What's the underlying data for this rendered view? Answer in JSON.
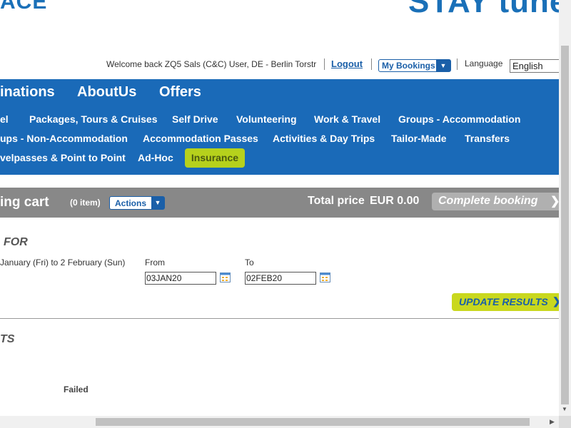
{
  "header": {
    "logo_left": "ACE",
    "logo_right": "STAY tuned"
  },
  "topbar": {
    "welcome": "Welcome back ZQ5 Sals (C&C) User, DE - Berlin Torstr",
    "logout": "Logout",
    "my_bookings": "My Bookings",
    "language_label": "Language",
    "language_value": "English"
  },
  "nav": {
    "main": [
      "inations",
      "AboutUs",
      "Offers"
    ],
    "sub_row1": [
      "el",
      "Packages, Tours & Cruises",
      "Self Drive",
      "Volunteering",
      "Work & Travel",
      "Groups - Accommodation"
    ],
    "sub_row2": [
      "ups - Non-Accommodation",
      "Accommodation Passes",
      "Activities & Day Trips",
      "Tailor-Made",
      "Transfers"
    ],
    "sub_row3": [
      "velpasses & Point to Point",
      "Ad-Hoc"
    ],
    "insurance": "Insurance"
  },
  "cart": {
    "title": "ing cart",
    "count": "(0 item)",
    "actions": "Actions",
    "total_label": "Total price",
    "total_value": "EUR 0.00",
    "complete": "Complete booking"
  },
  "search": {
    "heading": "FOR",
    "date_range": "January (Fri) to 2 February (Sun)",
    "from_label": "From",
    "from_value": "03JAN20",
    "to_label": "To",
    "to_value": "02FEB20",
    "update": "UPDATE RESULTS"
  },
  "results": {
    "heading": "TS",
    "status": "Failed"
  },
  "colors": {
    "nav_blue": "#1a6ab8",
    "insurance_green": "#b6d11c",
    "update_green": "#c9d81e",
    "cart_grey": "#888888"
  }
}
